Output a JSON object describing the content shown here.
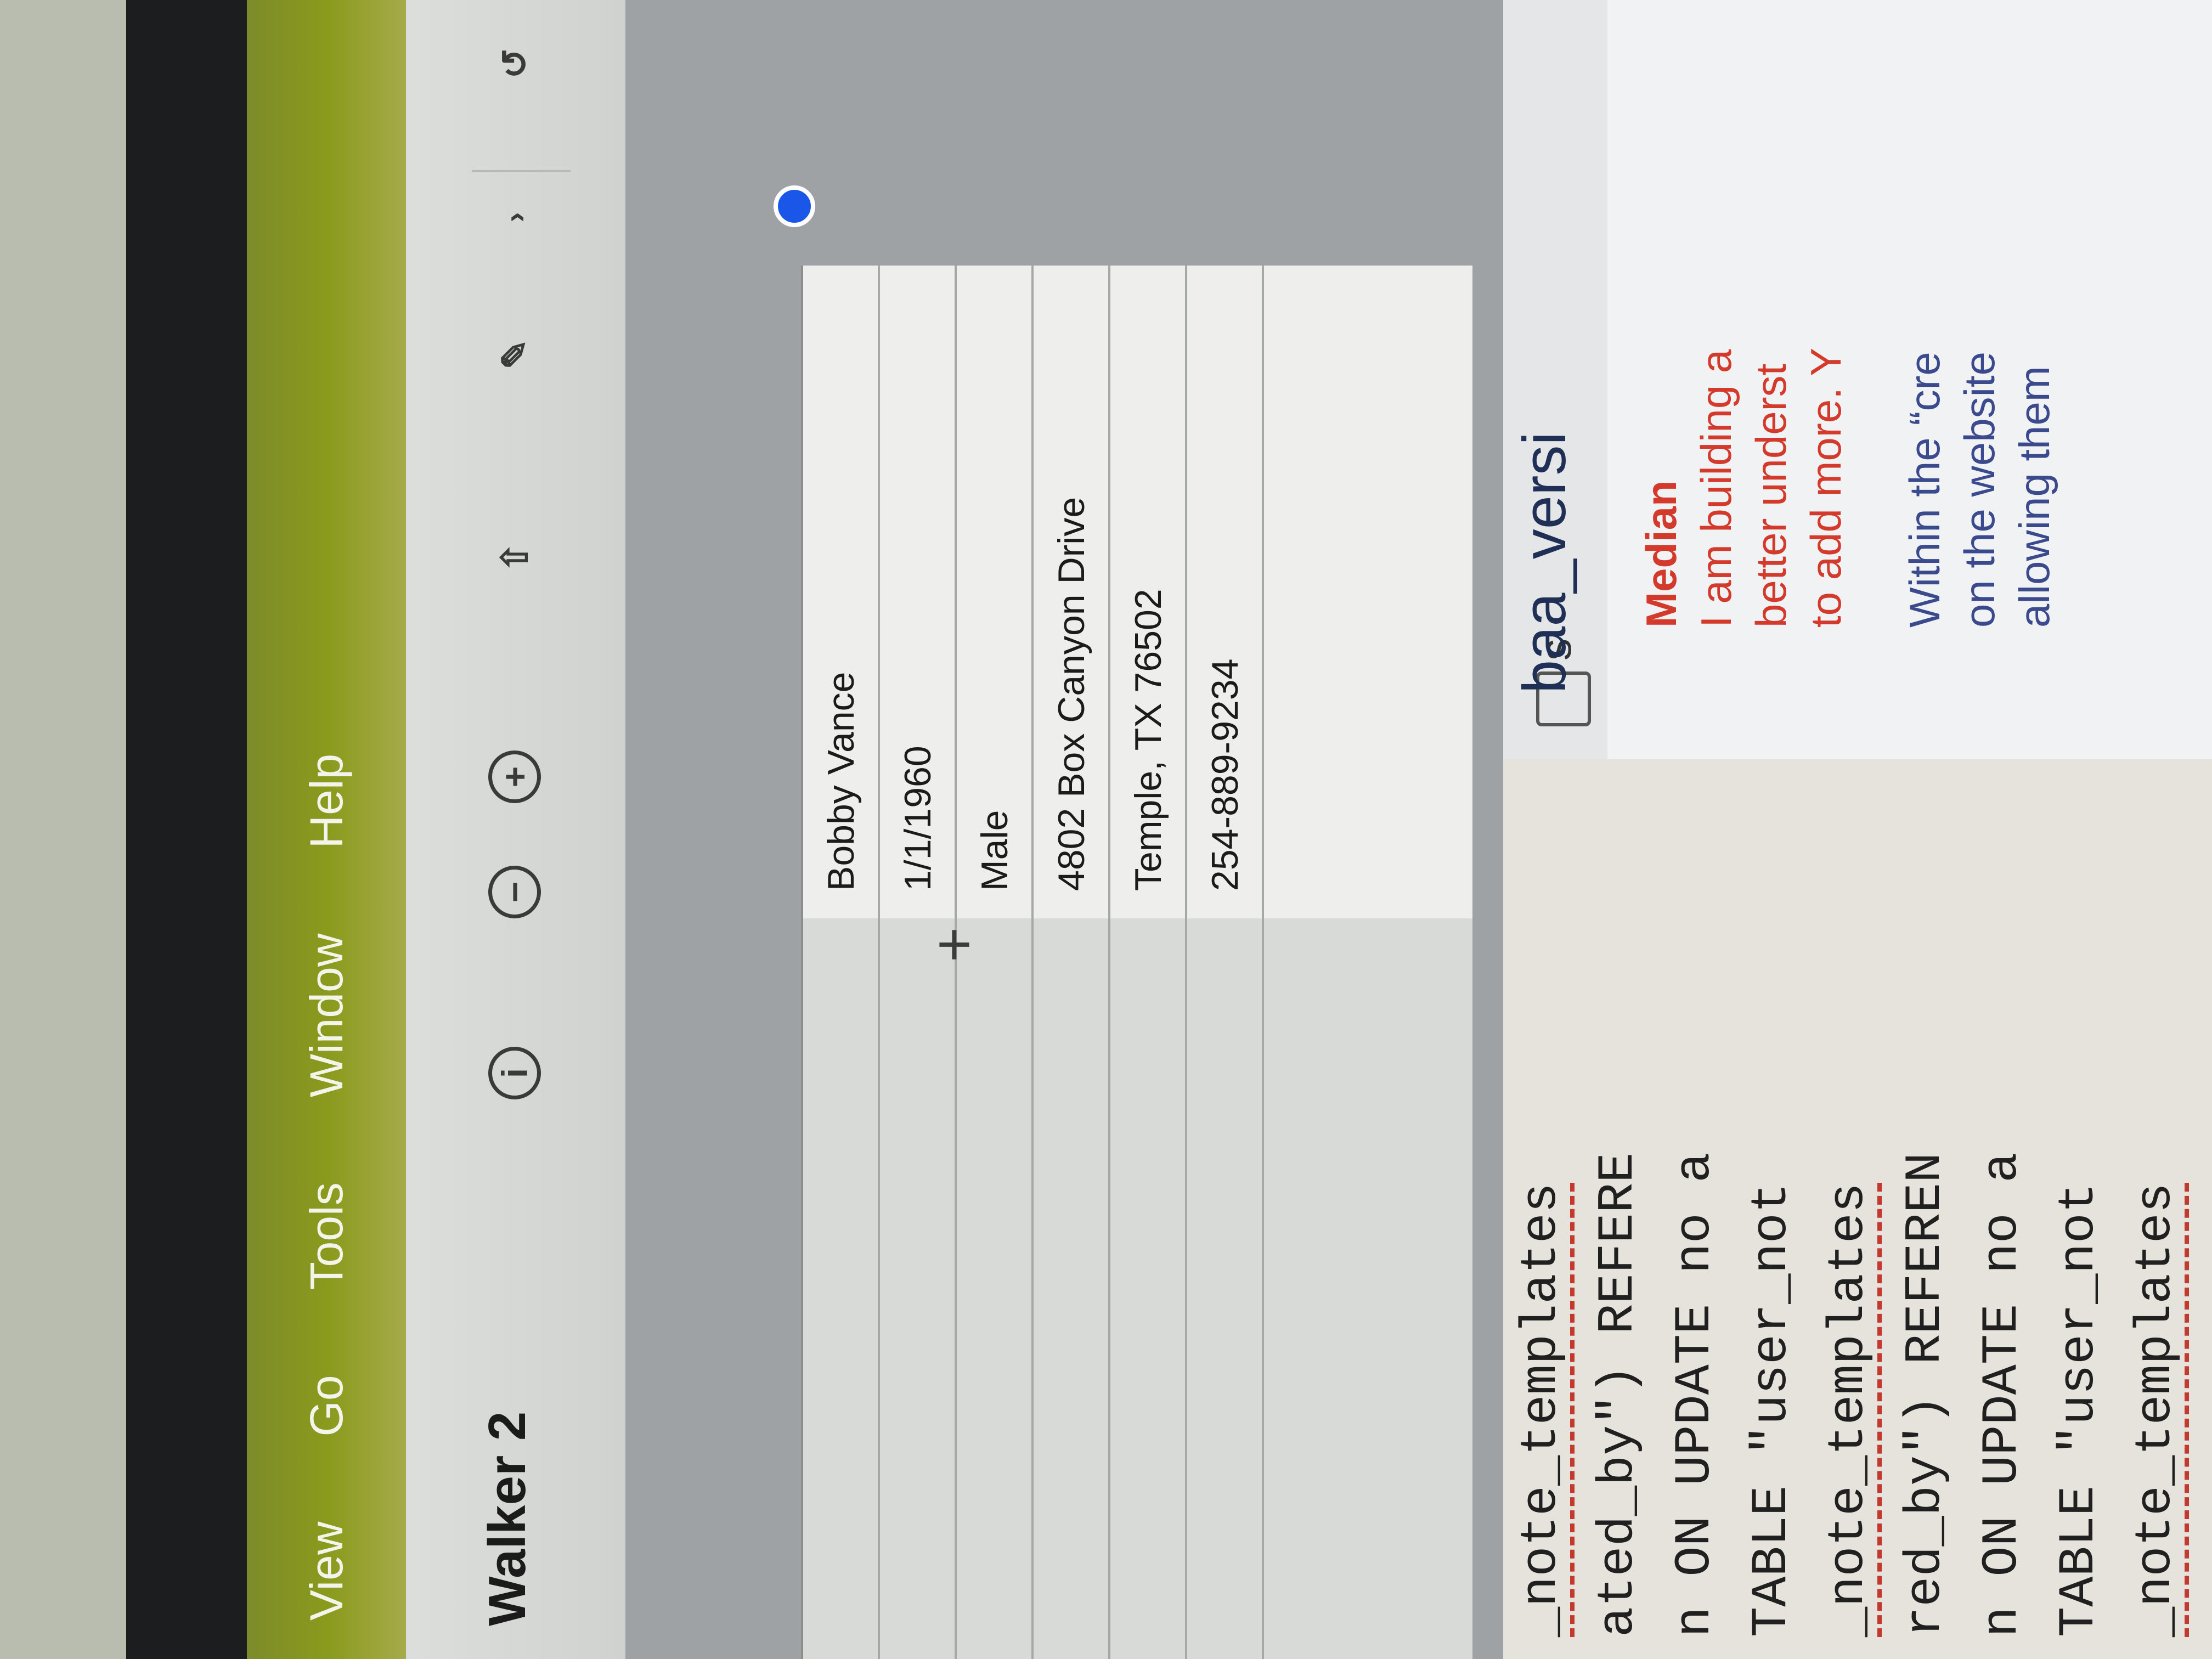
{
  "menu": [
    "View",
    "Go",
    "Tools",
    "Window",
    "Help"
  ],
  "window": {
    "title": "Walker 2"
  },
  "toolbar": {
    "info_glyph": "i",
    "zoom_out_glyph": "−",
    "zoom_in_glyph": "+",
    "share_glyph": "⇧",
    "markup_glyph": "✎",
    "more_glyph": "›",
    "rotate_glyph": "↺"
  },
  "table": {
    "add_glyph": "+",
    "rows": [
      {
        "value": "Bobby Vance"
      },
      {
        "value": "1/1/1960"
      },
      {
        "value": "Male"
      },
      {
        "value": "4802 Box Canyon Drive"
      },
      {
        "value": "Temple, TX 76502"
      },
      {
        "value": "254-889-9234"
      }
    ]
  },
  "code_editor": {
    "lines": [
      "_note_templates",
      "ated_by\") REFERE",
      "n ON UPDATE no a",
      "TABLE \"user_not",
      "_note_templates",
      "red_by\") REFEREN",
      "n ON UPDATE no a",
      "TABLE \"user_not",
      "_note_templates"
    ]
  },
  "side_panel": {
    "label": "s"
  },
  "document": {
    "title": "baa_versi",
    "heading": "Median",
    "para1": [
      "I am building a",
      "better underst",
      "to add more. Y"
    ],
    "para2": [
      "Within the “cre",
      "on the website",
      "allowing them"
    ]
  },
  "colors": {
    "menubar": "#8a9a1c",
    "selection_dot": "#1a57e8",
    "doc_heading": "#d43a2c"
  }
}
